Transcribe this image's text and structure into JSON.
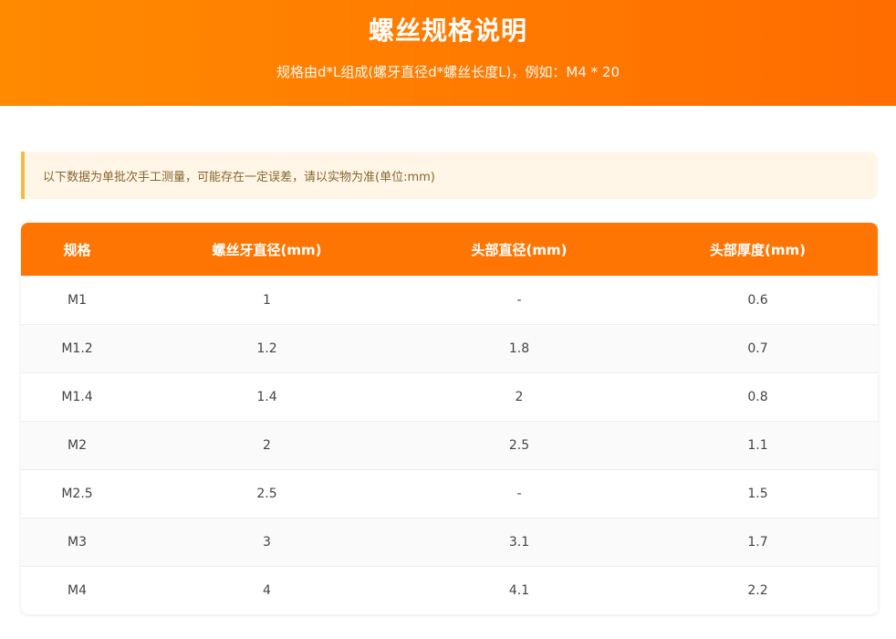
{
  "header": {
    "title": "螺丝规格说明",
    "subtitle": "规格由d*L组成(螺牙直径d*螺丝长度L)，例如：M4 * 20"
  },
  "notice": {
    "text": "以下数据为单批次手工测量，可能存在一定误差，请以实物为准(单位:mm)"
  },
  "table": {
    "columns": [
      "规格",
      "螺丝牙直径(mm)",
      "头部直径(mm)",
      "头部厚度(mm)"
    ],
    "rows": [
      [
        "M1",
        "1",
        "-",
        "0.6"
      ],
      [
        "M1.2",
        "1.2",
        "1.8",
        "0.7"
      ],
      [
        "M1.4",
        "1.4",
        "2",
        "0.8"
      ],
      [
        "M2",
        "2",
        "2.5",
        "1.1"
      ],
      [
        "M2.5",
        "2.5",
        "-",
        "1.5"
      ],
      [
        "M3",
        "3",
        "3.1",
        "1.7"
      ],
      [
        "M4",
        "4",
        "4.1",
        "2.2"
      ]
    ]
  },
  "colors": {
    "header_bg": "#ff7a00",
    "table_header_bg": "#ff7503",
    "notice_bg": "#fff6e8",
    "notice_border": "#f3bb44",
    "notice_text": "#86652a"
  }
}
